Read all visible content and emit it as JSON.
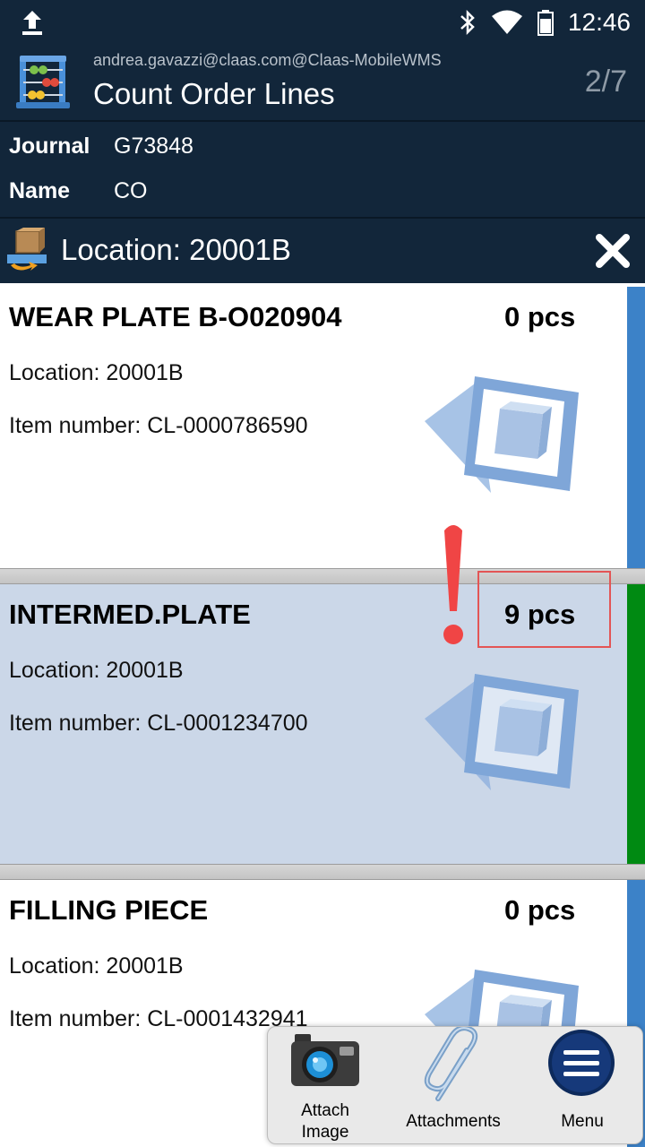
{
  "status": {
    "time": "12:46"
  },
  "header": {
    "user": "andrea.gavazzi@claas.com@Claas-MobileWMS",
    "title": "Count Order Lines",
    "page": "2/7"
  },
  "info": {
    "journal_label": "Journal",
    "journal_value": "G73848",
    "name_label": "Name",
    "name_value": "CO"
  },
  "location_bar": {
    "title": "Location: 20001B"
  },
  "lines": [
    {
      "name": "WEAR PLATE B-O020904",
      "qty": "0 pcs",
      "location": "Location: 20001B",
      "item": "Item number: CL-0000786590",
      "accent": "#3c82c8"
    },
    {
      "name": "INTERMED.PLATE",
      "qty": "9 pcs",
      "location": "Location: 20001B",
      "item": "Item number: CL-0001234700",
      "accent": "#008a12"
    },
    {
      "name": "FILLING PIECE",
      "qty": "0 pcs",
      "location": "Location: 20001B",
      "item": "Item number: CL-0001432941",
      "accent": "#3c82c8"
    }
  ],
  "actions": {
    "attach_image_line1": "Attach",
    "attach_image_line2": "Image",
    "attachments": "Attachments",
    "menu": "Menu"
  },
  "colors": {
    "header_bg": "#12263a",
    "selected_bg": "#cbd7e8",
    "highlight": "#e35555"
  }
}
